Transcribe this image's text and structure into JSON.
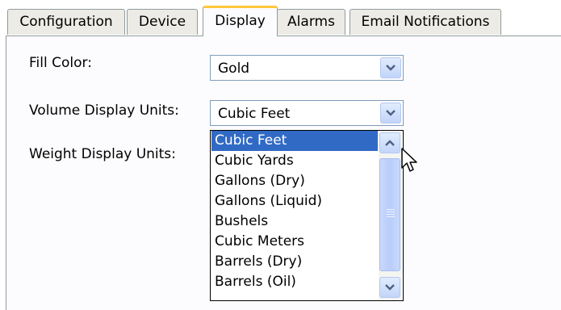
{
  "tabs": [
    {
      "label": "Configuration"
    },
    {
      "label": "Device"
    },
    {
      "label": "Display"
    },
    {
      "label": "Alarms"
    },
    {
      "label": "Email Notifications"
    }
  ],
  "active_tab": "Display",
  "form": {
    "fill_color": {
      "label": "Fill Color:",
      "value": "Gold"
    },
    "volume_units": {
      "label": "Volume Display Units:",
      "value": "Cubic Feet"
    },
    "weight_units": {
      "label": "Weight Display Units:"
    }
  },
  "dropdown": {
    "options": [
      {
        "label": "Cubic Feet",
        "selected": true
      },
      {
        "label": "Cubic Yards"
      },
      {
        "label": "Gallons (Dry)"
      },
      {
        "label": "Gallons (Liquid)"
      },
      {
        "label": "Bushels"
      },
      {
        "label": "Cubic Meters"
      },
      {
        "label": "Barrels (Dry)"
      },
      {
        "label": "Barrels (Oil)"
      }
    ]
  },
  "colors": {
    "selection": "#316ac5",
    "active_tab_accent": "#ffc83c",
    "panel_background": "#fcfcfe"
  },
  "icons": {
    "combo_button": "chevron-down-icon",
    "scroll_up": "chevron-up-icon",
    "scroll_down": "chevron-down-icon",
    "cursor": "mouse-pointer-icon"
  }
}
